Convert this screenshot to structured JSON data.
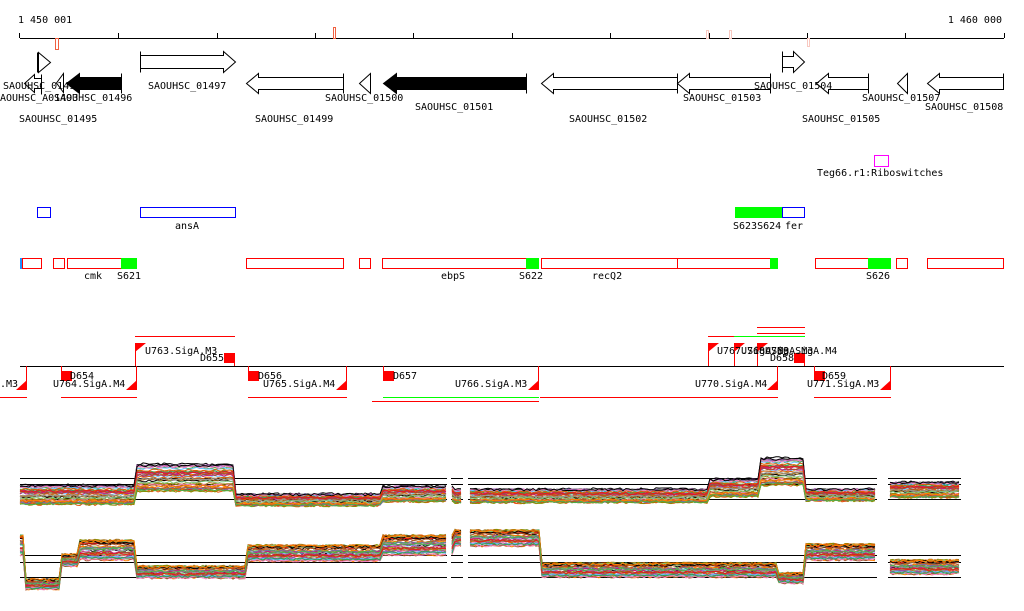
{
  "ruler": {
    "start_label": "1 450 001",
    "end_label": "1 460 000"
  },
  "colors": {
    "gene_stroke": "#000000",
    "feature_red": "#ff0000",
    "feature_green": "#00ff00",
    "feature_blue": "#0000ff",
    "riboswitch": "#ff00ff"
  },
  "genes": {
    "g01494": "SAOUHSC_01494",
    "gA01493": "SAOUHSC_A01493",
    "g01496": "SAOUHSC_01496",
    "g01495": "SAOUHSC_01495",
    "g01497": "SAOUHSC_01497",
    "g01499": "SAOUHSC_01499",
    "g01500": "SAOUHSC_01500",
    "g01501": "SAOUHSC_01501",
    "g01502": "SAOUHSC_01502",
    "g01503": "SAOUHSC_01503",
    "g01504": "SAOUHSC_01504",
    "g01505": "SAOUHSC_01505",
    "g01507": "SAOUHSC_01507",
    "g01508": "SAOUHSC_01508"
  },
  "riboswitch": {
    "label": "Teg66.r1:Riboswitches"
  },
  "annotations": {
    "ansA": "ansA",
    "s623s624": "S623S624",
    "fer": "fer"
  },
  "transcripts": {
    "cmk": "cmk",
    "s621": "S621",
    "ebpS": "ebpS",
    "s622": "S622",
    "recQ2": "recQ2",
    "s626": "S626"
  },
  "promoters": {
    "u762": ".M3",
    "u764": "U764.SigA.M4",
    "d654": "D654",
    "u763": "U763.SigA.M3",
    "d655": "D655",
    "d656": "D656",
    "u765": "U765.SigA.M4",
    "d657": "D657",
    "u766": "U766.SigA.M3",
    "u767": "U767.SigA.M3",
    "u768": "U768.SigA.M3",
    "u769": "U769.SigA.M4",
    "d658": "D658",
    "u770": "U770.SigA.M4",
    "d659": "D659",
    "u771": "U771.SigA.M3"
  }
}
